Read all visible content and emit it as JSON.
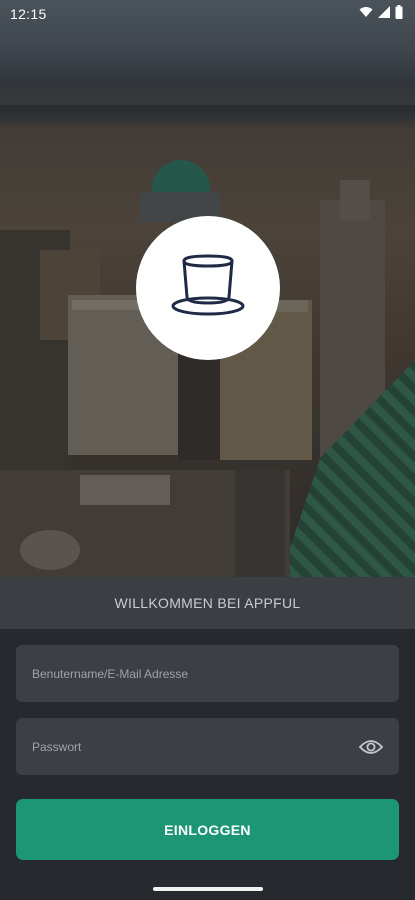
{
  "status_bar": {
    "time": "12:15",
    "icons": [
      "wifi-icon",
      "signal-icon",
      "battery-icon"
    ]
  },
  "hero": {
    "logo_icon": "top-hat-icon"
  },
  "welcome": {
    "text": "WILLKOMMEN BEI APPFUL"
  },
  "form": {
    "username_placeholder": "Benutername/E-Mail Adresse",
    "username_value": "",
    "password_placeholder": "Passwort",
    "password_value": "",
    "password_toggle_icon": "eye-icon",
    "login_label": "EINLOGGEN"
  },
  "colors": {
    "accent": "#1d9676",
    "background": "#262a2e",
    "field": "#3c4045",
    "band": "#3b3f44"
  }
}
